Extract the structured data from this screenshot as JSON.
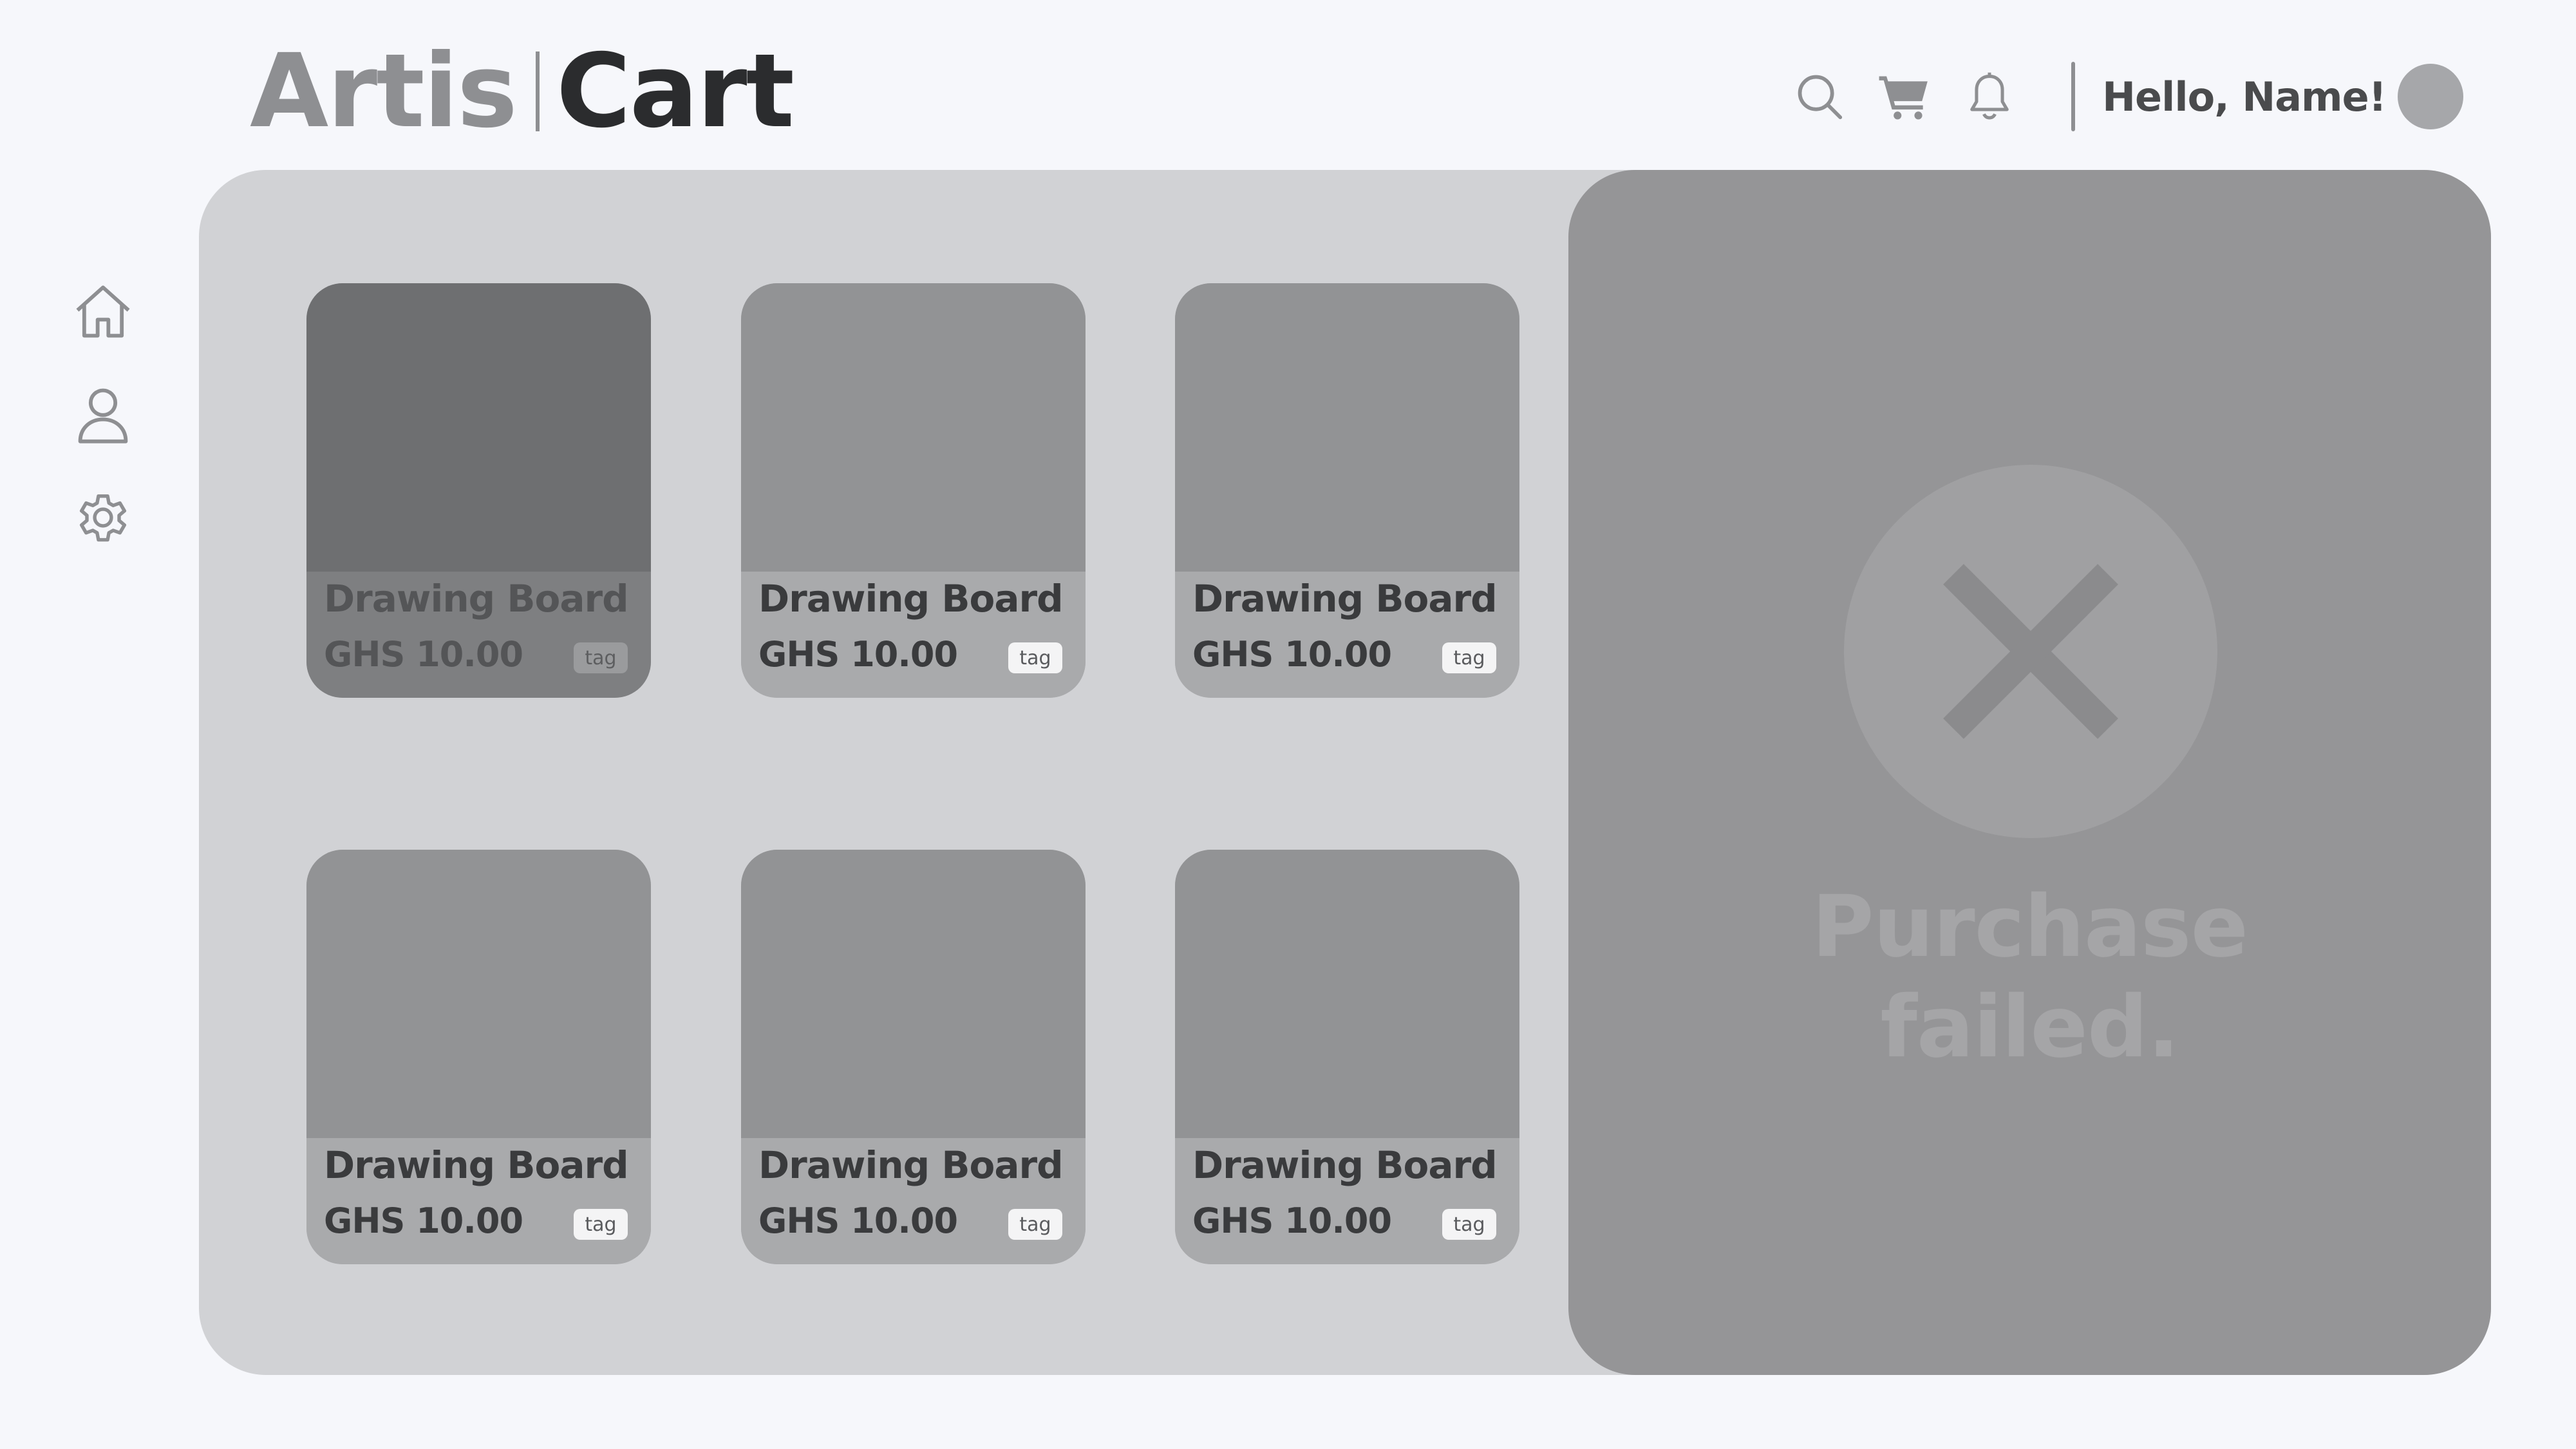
{
  "brand": {
    "part1": "Artis",
    "part2": "Cart"
  },
  "header": {
    "greeting": "Hello, Name!",
    "icons": [
      "search-icon",
      "cart-icon",
      "bell-icon"
    ]
  },
  "sidebar": {
    "items": [
      {
        "icon": "home-icon"
      },
      {
        "icon": "user-icon"
      },
      {
        "icon": "gear-icon"
      }
    ]
  },
  "products": [
    {
      "title": "Drawing Board",
      "price": "GHS 10.00",
      "tag": "tag",
      "selected": true
    },
    {
      "title": "Drawing Board",
      "price": "GHS 10.00",
      "tag": "tag"
    },
    {
      "title": "Drawing Board",
      "price": "GHS 10.00",
      "tag": "tag"
    },
    {
      "title": "Drawing Board",
      "price": "GHS 10.00",
      "tag": "tag"
    },
    {
      "title": "Drawing Board",
      "price": "GHS 10.00",
      "tag": "tag"
    },
    {
      "title": "Drawing Board",
      "price": "GHS 10.00",
      "tag": "tag"
    }
  ],
  "status": {
    "icon": "close-icon",
    "line1": "Purchase",
    "line2": "failed."
  },
  "colors": {
    "background": "#f6f7fb",
    "panel": "#d1d2d5",
    "overlay": "#959597",
    "text_dark": "#2b2c2e",
    "text_muted": "#8e8f92"
  }
}
